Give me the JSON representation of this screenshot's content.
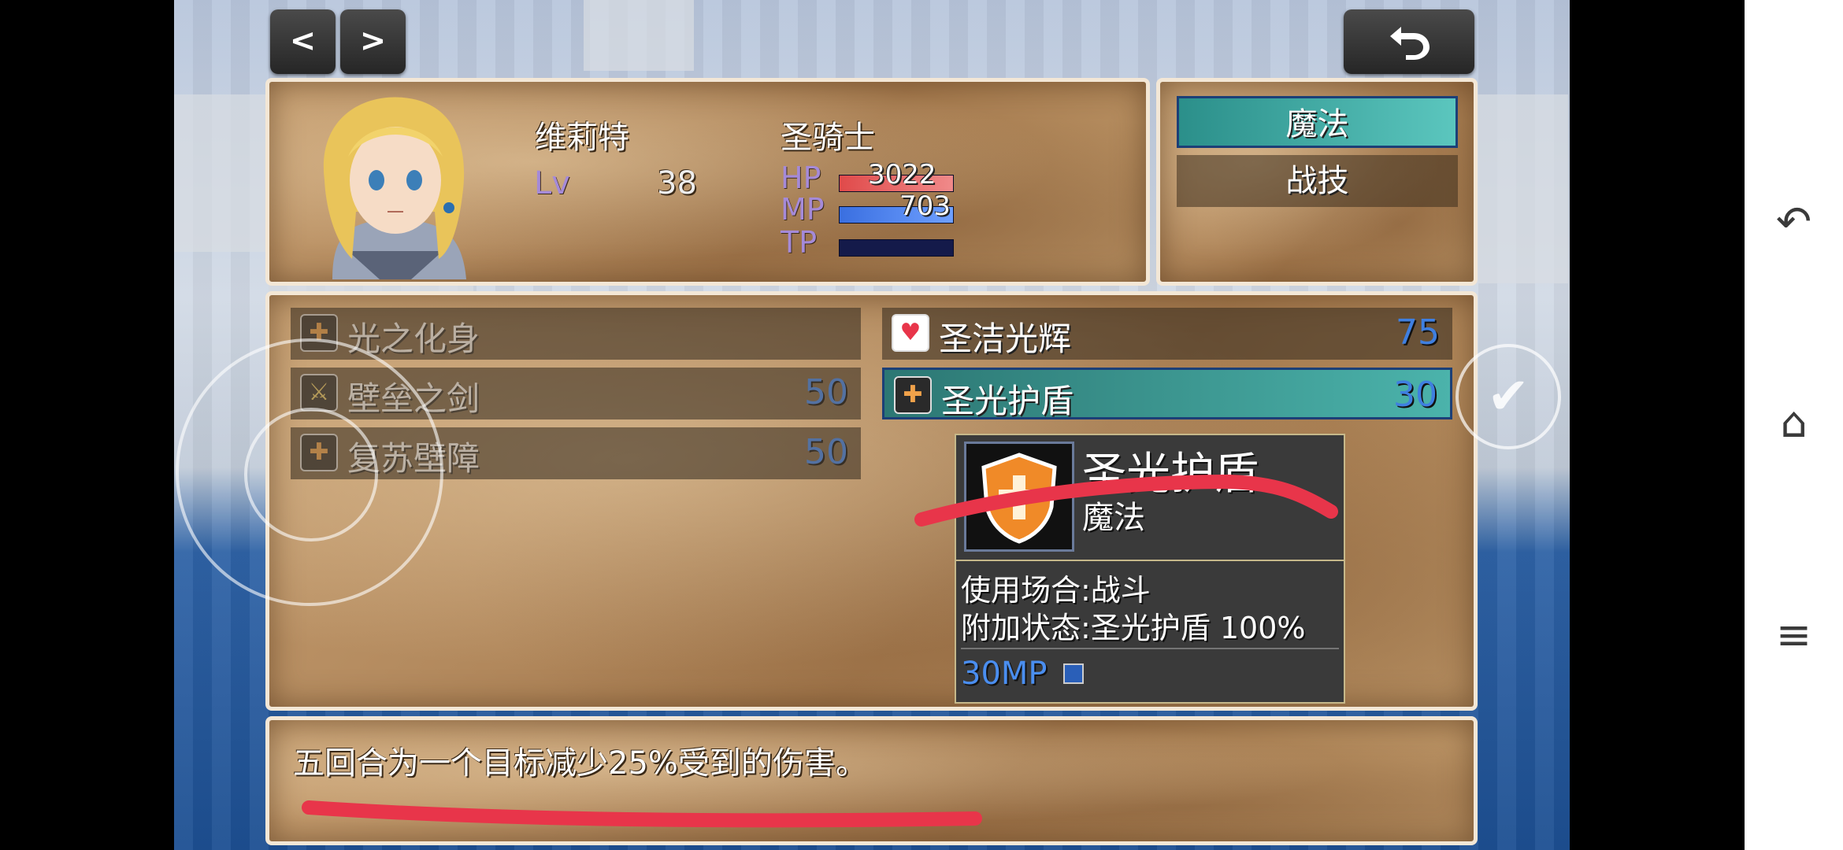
{
  "topbar": {
    "prev": "<",
    "next": ">",
    "back": "back-arrow-icon"
  },
  "actor": {
    "name": "维莉特",
    "class": "圣骑士",
    "level_label": "Lv",
    "level": "38",
    "hp_label": "HP",
    "hp": "3022",
    "mp_label": "MP",
    "mp": "703",
    "tp_label": "TP",
    "hp_ratio": 1.0,
    "mp_ratio": 1.0,
    "tp_ratio": 0.0
  },
  "commands": [
    {
      "label": "魔法",
      "selected": true
    },
    {
      "label": "战技",
      "selected": false
    }
  ],
  "skills": [
    {
      "name": "光之化身",
      "cost": "",
      "icon": "shield-icon",
      "enabled": false
    },
    {
      "name": "圣洁光辉",
      "cost": "75",
      "icon": "heart-icon",
      "enabled": true
    },
    {
      "name": "壁垒之剑",
      "cost": "50",
      "icon": "sword-icon",
      "enabled": false
    },
    {
      "name": "圣光护盾",
      "cost": "30",
      "icon": "shield-icon",
      "enabled": true,
      "selected": true
    },
    {
      "name": "复苏壁障",
      "cost": "50",
      "icon": "shield-icon",
      "enabled": false
    }
  ],
  "tooltip": {
    "title": "圣光护盾",
    "type": "魔法",
    "occasion": "使用场合:战斗",
    "state": "附加状态:圣光护盾 100%",
    "cost": "30MP"
  },
  "help_text": "五回合为一个目标减少25%受到的伤害。",
  "colors": {
    "hp_gauge": "#e04a4a",
    "mp_gauge": "#3a6fe0",
    "cost": "#3f7fe0",
    "annotation_red": "#e8354a"
  }
}
